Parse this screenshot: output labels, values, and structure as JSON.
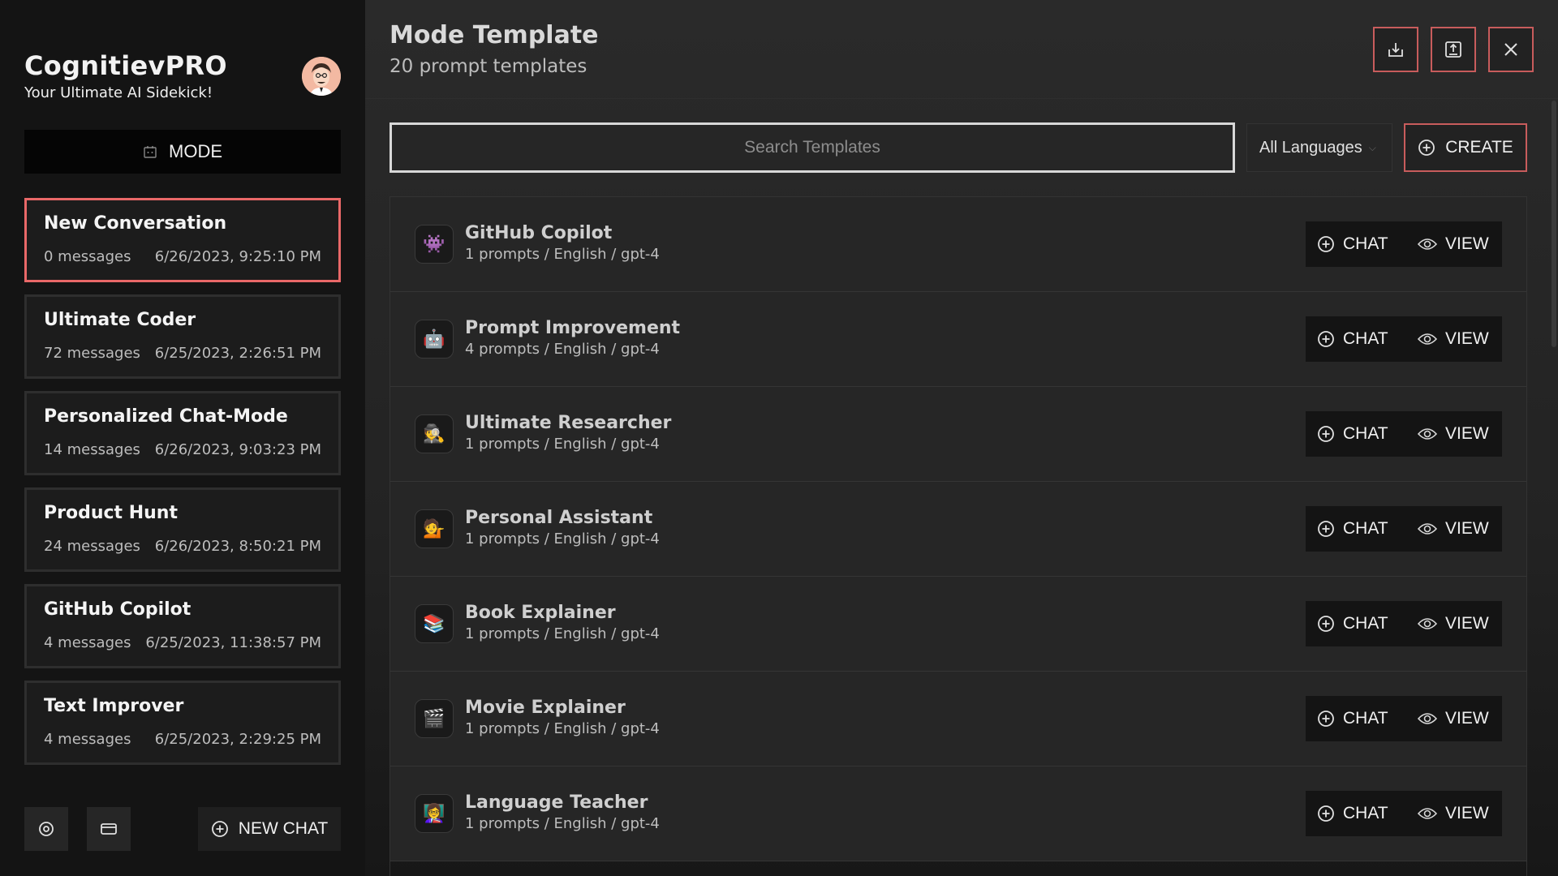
{
  "app": {
    "name": "CognitievPRO",
    "tagline": "Your Ultimate AI Sidekick!"
  },
  "sidebar": {
    "mode_label": "MODE",
    "new_chat_label": "NEW CHAT",
    "conversations": [
      {
        "title": "New Conversation",
        "messages": "0 messages",
        "date": "6/26/2023, 9:25:10 PM",
        "active": true
      },
      {
        "title": "Ultimate Coder",
        "messages": "72 messages",
        "date": "6/25/2023, 2:26:51 PM",
        "active": false
      },
      {
        "title": "Personalized Chat-Mode",
        "messages": "14 messages",
        "date": "6/26/2023, 9:03:23 PM",
        "active": false
      },
      {
        "title": "Product Hunt",
        "messages": "24 messages",
        "date": "6/26/2023, 8:50:21 PM",
        "active": false
      },
      {
        "title": "GitHub Copilot",
        "messages": "4 messages",
        "date": "6/25/2023, 11:38:57 PM",
        "active": false
      },
      {
        "title": "Text Improver",
        "messages": "4 messages",
        "date": "6/25/2023, 2:29:25 PM",
        "active": false
      }
    ]
  },
  "main": {
    "title": "Mode Template",
    "subtitle": "20 prompt templates",
    "search_placeholder": "Search Templates",
    "language_filter": "All Languages",
    "create_label": "CREATE",
    "chat_label": "CHAT",
    "view_label": "VIEW",
    "templates": [
      {
        "name": "GitHub Copilot",
        "meta": "1 prompts / English / gpt-4",
        "icon": "👾",
        "icon_name": "alien-monster-icon"
      },
      {
        "name": "Prompt Improvement",
        "meta": "4 prompts / English / gpt-4",
        "icon": "🤖",
        "icon_name": "robot-icon"
      },
      {
        "name": "Ultimate Researcher",
        "meta": "1 prompts / English / gpt-4",
        "icon": "🕵",
        "icon_name": "detective-icon"
      },
      {
        "name": "Personal Assistant",
        "meta": "1 prompts / English / gpt-4",
        "icon": "💁",
        "icon_name": "assistant-icon"
      },
      {
        "name": "Book Explainer",
        "meta": "1 prompts / English / gpt-4",
        "icon": "📚",
        "icon_name": "books-icon"
      },
      {
        "name": "Movie Explainer",
        "meta": "1 prompts / English / gpt-4",
        "icon": "🎬",
        "icon_name": "clapper-board-icon"
      },
      {
        "name": "Language Teacher",
        "meta": "1 prompts / English / gpt-4",
        "icon": "👩‍🏫",
        "icon_name": "teacher-icon"
      }
    ]
  },
  "colors": {
    "accent": "#e96868",
    "sidebar_bg": "#141414",
    "main_bg": "#262626"
  }
}
